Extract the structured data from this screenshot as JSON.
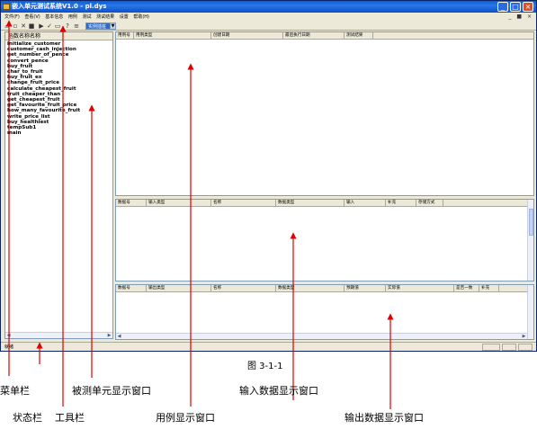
{
  "window": {
    "title": "嵌入单元测试系统V1.0 - pl.dys",
    "controls": {
      "min": "_",
      "max": "□",
      "close": "×"
    }
  },
  "menu": [
    "文件(F)",
    "查看(V)",
    "基本信息",
    "用例",
    "测试",
    "测试结果",
    "设置",
    "帮助(H)"
  ],
  "mdi_controls": "_ ■ ×",
  "toolbar": {
    "combo_value": "实例插桩"
  },
  "function_pane": {
    "header": "函数名称名称",
    "items": [
      "initialize_customer",
      "customer_cash_injection",
      "get_number_of_pence",
      "convert_pence",
      "buy_fruit",
      "char_to_fruit",
      "buy_fruit_ex",
      "change_fruit_price",
      "calculate_cheapest_fruit",
      "fruit_cheaper_than",
      "get_cheapest_fruit",
      "get_favourite_fruit_price",
      "how_many_favourite_fruit",
      "write_price_list",
      "buy_healthiest",
      "tempSub1",
      "main"
    ]
  },
  "case_pane": {
    "columns": [
      "用例号",
      "用例类型",
      "创建日期",
      "最后执行日期",
      "测试结果"
    ]
  },
  "input_pane": {
    "columns": [
      "数据号",
      "输入类型",
      "名称",
      "数据类型",
      "输入",
      "补充",
      "存储方式"
    ]
  },
  "output_pane": {
    "columns": [
      "数据号",
      "输出类型",
      "名称",
      "数据类型",
      "预期值",
      "实际值",
      "是否一致",
      "补充"
    ]
  },
  "status": {
    "text": "就绪"
  },
  "caption": "图 3-1-1",
  "labels": {
    "menu": "菜单栏",
    "status": "状态栏",
    "toolbar": "工具栏",
    "unit_window": "被测单元显示窗口",
    "case_window": "用例显示窗口",
    "input_window": "输入数据显示窗口",
    "output_window": "输出数据显示窗口"
  }
}
